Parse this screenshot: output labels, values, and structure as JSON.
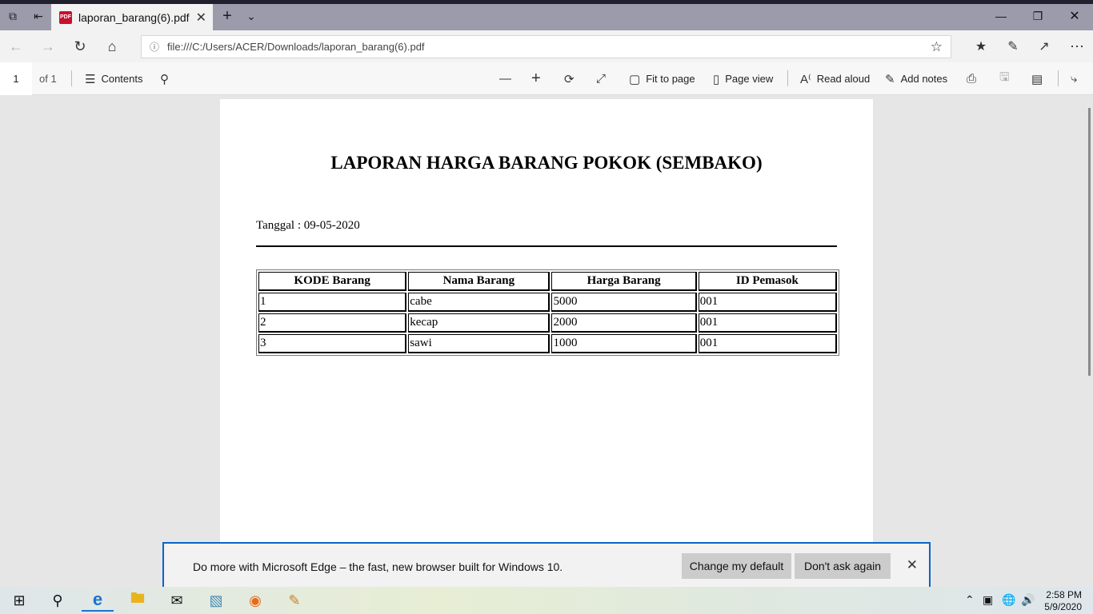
{
  "browser": {
    "tab_title": "laporan_barang(6).pdf",
    "tab_badge": "PDF",
    "address": "file:///C:/Users/ACER/Downloads/laporan_barang(6).pdf"
  },
  "pdf_toolbar": {
    "page_number": "1",
    "page_of": "of 1",
    "contents_label": "Contents",
    "fit_label": "Fit to page",
    "page_view_label": "Page view",
    "read_aloud_label": "Read aloud",
    "add_notes_label": "Add notes"
  },
  "document": {
    "title": "LAPORAN HARGA BARANG POKOK (SEMBAKO)",
    "date_line": "Tanggal : 09-05-2020",
    "table": {
      "headers": [
        "KODE Barang",
        "Nama Barang",
        "Harga Barang",
        "ID Pemasok"
      ],
      "rows": [
        [
          "1",
          "cabe",
          "5000",
          "001"
        ],
        [
          "2",
          "kecap",
          "2000",
          "001"
        ],
        [
          "3",
          "sawi",
          "1000",
          "001"
        ]
      ]
    }
  },
  "notification": {
    "message": "Do more with Microsoft Edge – the fast, new browser built for Windows 10.",
    "change_default_label": "Change my default",
    "dont_ask_label": "Don't ask again"
  },
  "taskbar": {
    "time": "2:58 PM",
    "date": "5/9/2020"
  }
}
